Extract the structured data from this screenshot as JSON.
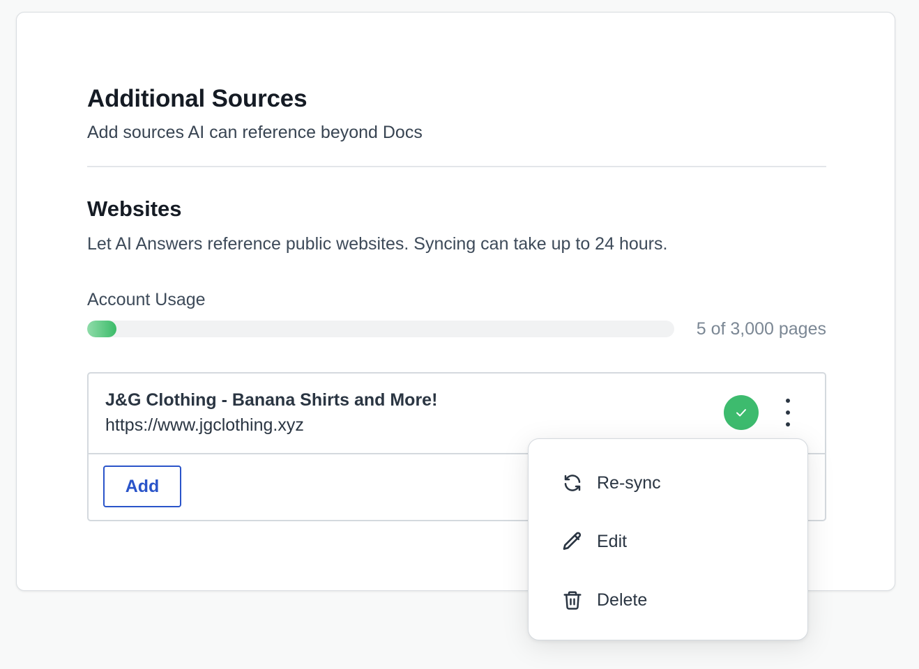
{
  "page": {
    "title": "Additional Sources",
    "subtitle": "Add sources AI can reference beyond Docs"
  },
  "websites": {
    "title": "Websites",
    "description": "Let AI Answers reference public websites. Syncing can take up to 24 hours.",
    "usage": {
      "label": "Account Usage",
      "count_text": "5 of 3,000 pages",
      "used": 5,
      "total": 3000
    },
    "sites": [
      {
        "name": "J&G Clothing - Banana Shirts and More!",
        "url": "https://www.jgclothing.xyz",
        "status": "synced",
        "status_icon": "check-icon"
      }
    ],
    "add_button_label": "Add"
  },
  "context_menu": {
    "items": [
      {
        "label": "Re-sync",
        "icon": "refresh-icon"
      },
      {
        "label": "Edit",
        "icon": "pencil-icon"
      },
      {
        "label": "Delete",
        "icon": "trash-icon"
      }
    ]
  },
  "colors": {
    "accent": "#2a54c9",
    "success": "#3dbb6e",
    "progress_start": "#8fdca9",
    "progress_end": "#3bbb69"
  }
}
